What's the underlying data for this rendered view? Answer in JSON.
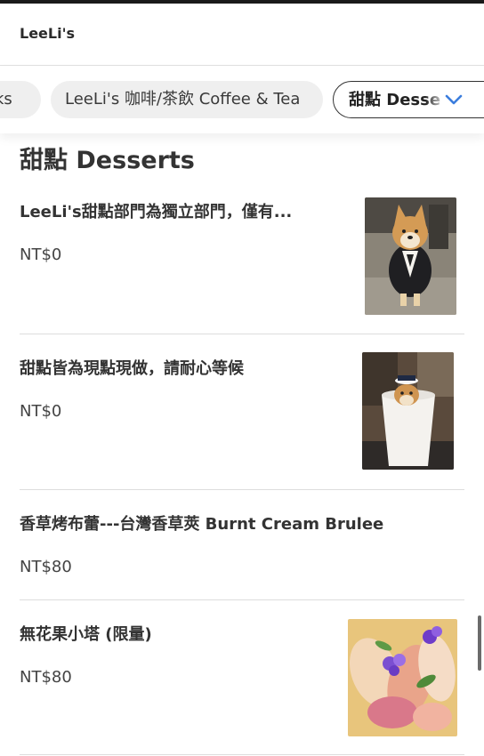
{
  "header": {
    "brand": "LeeLi's"
  },
  "category_tabs": {
    "partial_label": "ks",
    "items": [
      {
        "label": "LeeLi's 咖啡/茶飲 Coffee & Tea",
        "active": false
      },
      {
        "label": "甜點 Desserts",
        "active": true
      }
    ],
    "dropdown_icon": "chevron-down-icon"
  },
  "section": {
    "title": "甜點 Desserts"
  },
  "menu_items": [
    {
      "name": "LeeLi's甜點部門為獨立部門，僅有...",
      "price": "NT$0",
      "image": "shiba-dog-in-suit-photo"
    },
    {
      "name": "甜點皆為現點現做，請耐心等候",
      "price": "NT$0",
      "image": "shiba-dog-in-cup-photo"
    },
    {
      "name": "香草烤布蕾---台灣香草莢 Burnt Cream Brulee",
      "price": "NT$80",
      "image": null
    },
    {
      "name": "無花果小塔 (限量)",
      "price": "NT$80",
      "image": "fig-tart-photo"
    }
  ],
  "colors": {
    "accent": "#3b7ddd",
    "text": "#333333",
    "tab_bg": "#efefef",
    "divider": "#dddddd"
  }
}
